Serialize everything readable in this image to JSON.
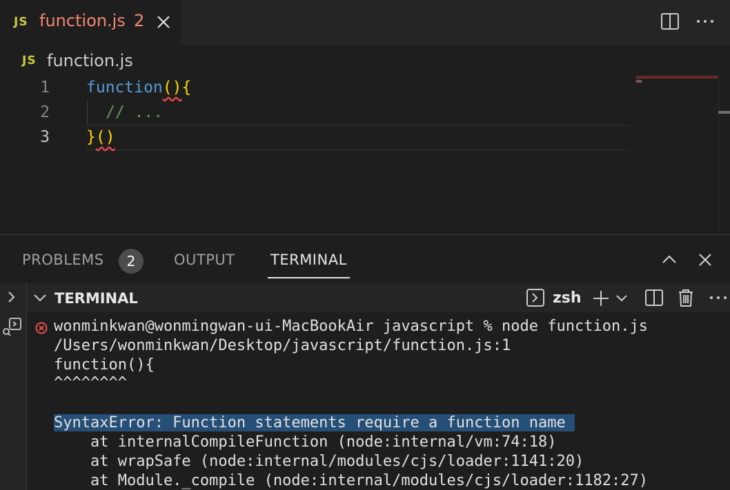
{
  "editor": {
    "tab": {
      "lang_badge": "JS",
      "filename": "function.js",
      "problem_count": "2"
    },
    "actions": {
      "split": "split-editor-icon",
      "more": "more-actions-icon"
    },
    "breadcrumb": {
      "lang_badge": "JS",
      "file": "function.js"
    },
    "lines": [
      {
        "number": "1",
        "kw": "function",
        "paren": "()",
        "brace": "{"
      },
      {
        "number": "2",
        "comment": "// ..."
      },
      {
        "number": "3",
        "brace": "}",
        "paren": "()"
      }
    ]
  },
  "panel": {
    "tabs": [
      {
        "label": "PROBLEMS",
        "badge": "2"
      },
      {
        "label": "OUTPUT"
      },
      {
        "label": "TERMINAL"
      }
    ],
    "active_tab": "TERMINAL"
  },
  "terminal": {
    "title": "TERMINAL",
    "shell": "zsh",
    "lines": [
      "wonminkwan@wonmingwan-ui-MacBookAir javascript % node function.js",
      "/Users/wonminkwan/Desktop/javascript/function.js:1",
      "function(){",
      "^^^^^^^^",
      "",
      "SyntaxError: Function statements require a function name ",
      "    at internalCompileFunction (node:internal/vm:74:18)",
      "    at wrapSafe (node:internal/modules/cjs/loader:1141:20)",
      "    at Module._compile (node:internal/modules/cjs/loader:1182:27)"
    ]
  },
  "colors": {
    "background": "#1e1e1e",
    "error": "#f48771",
    "keyword": "#569cd6",
    "bracket": "#ffd700",
    "comment": "#6a9955",
    "selection": "#264f78"
  }
}
